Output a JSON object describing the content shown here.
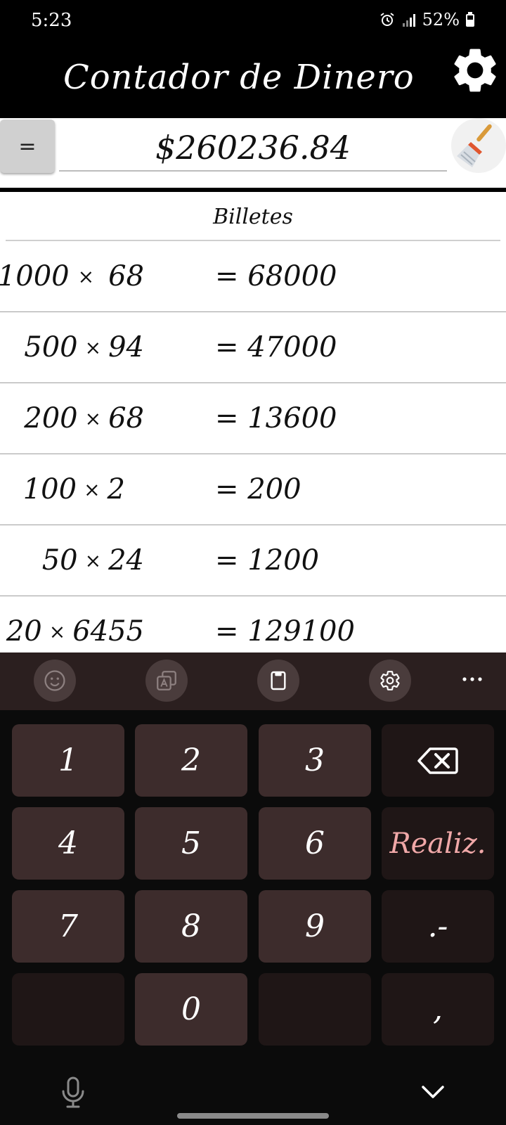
{
  "status_bar": {
    "time": "5:23",
    "battery": "52%",
    "icons": [
      "alarm-icon",
      "signal-icon",
      "battery-icon"
    ]
  },
  "app_bar": {
    "title": "Contador de Dinero",
    "settings_icon": "gear-icon"
  },
  "total_bar": {
    "equals_label": "=",
    "total_value": "$260236.84",
    "clear_icon": "broom-icon"
  },
  "bills": {
    "section_title": "Billetes",
    "rows": [
      {
        "denomination": "1000",
        "times": "×",
        "count": "68",
        "result": "= 68000"
      },
      {
        "denomination": "500",
        "times": "×",
        "count": "94",
        "result": "= 47000"
      },
      {
        "denomination": "200",
        "times": "×",
        "count": "68",
        "result": "= 13600"
      },
      {
        "denomination": "100",
        "times": "×",
        "count": "2",
        "result": "= 200"
      },
      {
        "denomination": "50",
        "times": "×",
        "count": "24",
        "result": "= 1200"
      },
      {
        "denomination": "20",
        "times": "×",
        "count": "6455",
        "result": "= 129100"
      }
    ]
  },
  "keyboard_toolbar": {
    "icons": [
      "emoji-icon",
      "translate-icon",
      "clipboard-icon",
      "gear-icon",
      "more-icon"
    ]
  },
  "keyboard": {
    "keys": [
      "1",
      "2",
      "3",
      "4",
      "5",
      "6",
      "7",
      "8",
      "9",
      "0",
      ".-",
      ","
    ],
    "done_label": "Realiz."
  },
  "bottom_bar": {
    "icons": [
      "microphone-icon",
      "chevron-down-icon"
    ]
  },
  "colors": {
    "key": "#3d2c2c",
    "key_dark": "#1f1616",
    "done_text": "#f0a8a8",
    "toolbar": "#2b1f1f"
  }
}
